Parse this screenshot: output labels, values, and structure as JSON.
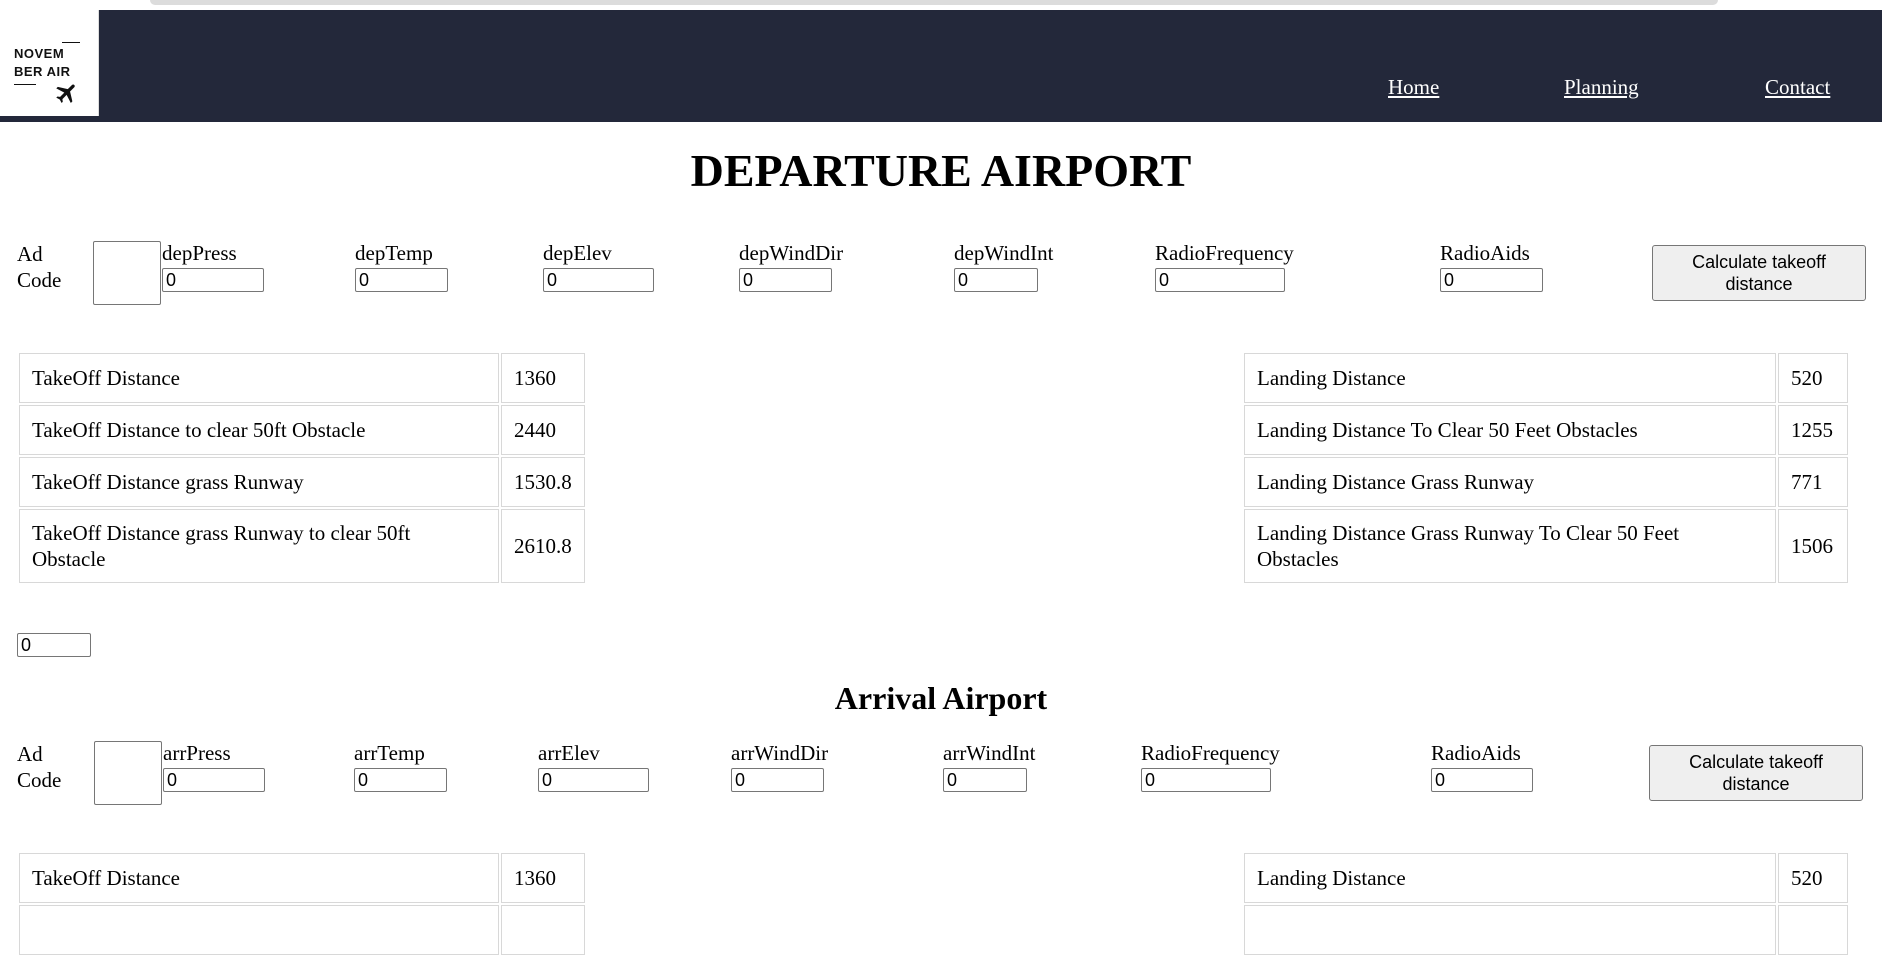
{
  "header": {
    "logo_line1": "NOVEM",
    "logo_line2": "BER AIR",
    "nav": [
      "Home",
      "Planning",
      "Contact"
    ]
  },
  "departure": {
    "title": "DEPARTURE AIRPORT",
    "ad_code_label": "Ad Code",
    "fields": [
      {
        "label": "depPress",
        "value": "0"
      },
      {
        "label": "depTemp",
        "value": "0"
      },
      {
        "label": "depElev",
        "value": "0"
      },
      {
        "label": "depWindDir",
        "value": "0"
      },
      {
        "label": "depWindInt",
        "value": "0"
      },
      {
        "label": "RadioFrequency",
        "value": "0"
      },
      {
        "label": "RadioAids",
        "value": "0"
      }
    ],
    "button": "Calculate takeoff distance",
    "takeoff_table": [
      [
        "TakeOff Distance",
        "1360"
      ],
      [
        "TakeOff Distance to clear 50ft Obstacle",
        "2440"
      ],
      [
        "TakeOff Distance grass Runway",
        "1530.8"
      ],
      [
        "TakeOff Distance grass Runway to clear 50ft Obstacle",
        "2610.8"
      ]
    ],
    "landing_table": [
      [
        "Landing Distance",
        "520"
      ],
      [
        "Landing Distance To Clear 50 Feet Obstacles",
        "1255"
      ],
      [
        "Landing Distance Grass Runway",
        "771"
      ],
      [
        "Landing Distance Grass Runway To Clear 50 Feet Obstacles",
        "1506"
      ]
    ],
    "extra_value": "0"
  },
  "arrival": {
    "title": "Arrival Airport",
    "ad_code_label": "Ad Code",
    "fields": [
      {
        "label": "arrPress",
        "value": "0"
      },
      {
        "label": "arrTemp",
        "value": "0"
      },
      {
        "label": "arrElev",
        "value": "0"
      },
      {
        "label": "arrWindDir",
        "value": "0"
      },
      {
        "label": "arrWindInt",
        "value": "0"
      },
      {
        "label": "RadioFrequency",
        "value": "0"
      },
      {
        "label": "RadioAids",
        "value": "0"
      }
    ],
    "button": "Calculate takeoff distance",
    "takeoff_table": [
      [
        "TakeOff Distance",
        "1360"
      ]
    ],
    "landing_table": [
      [
        "Landing Distance",
        "520"
      ]
    ]
  }
}
